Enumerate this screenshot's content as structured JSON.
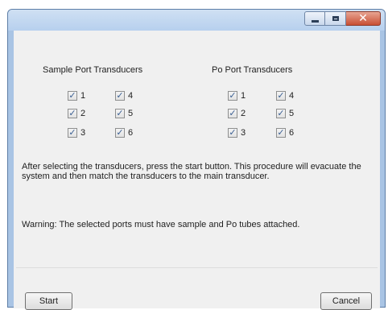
{
  "window": {
    "minimize_icon": "minimize-icon",
    "maximize_icon": "maximize-icon",
    "close_icon": "close-icon",
    "close_glyph": "✕"
  },
  "sample_group": {
    "title": "Sample Port Transducers",
    "items": [
      {
        "label": "1",
        "checked": true
      },
      {
        "label": "4",
        "checked": true
      },
      {
        "label": "2",
        "checked": true
      },
      {
        "label": "5",
        "checked": true
      },
      {
        "label": "3",
        "checked": true
      },
      {
        "label": "6",
        "checked": true
      }
    ]
  },
  "po_group": {
    "title": "Po Port Transducers",
    "items": [
      {
        "label": "1",
        "checked": true
      },
      {
        "label": "4",
        "checked": true
      },
      {
        "label": "2",
        "checked": true
      },
      {
        "label": "5",
        "checked": true
      },
      {
        "label": "3",
        "checked": true
      },
      {
        "label": "6",
        "checked": true
      }
    ]
  },
  "check_glyph": "✓",
  "instructions": "After selecting the transducers, press the start button. This procedure will evacuate the system and then match the transducers to the main transducer.",
  "warning": "Warning: The selected ports must have sample and Po tubes attached.",
  "buttons": {
    "start": "Start",
    "cancel": "Cancel"
  },
  "colors": {
    "frame": "#a9c4e4",
    "client": "#f0f0f0",
    "close_button": "#c84e33"
  }
}
